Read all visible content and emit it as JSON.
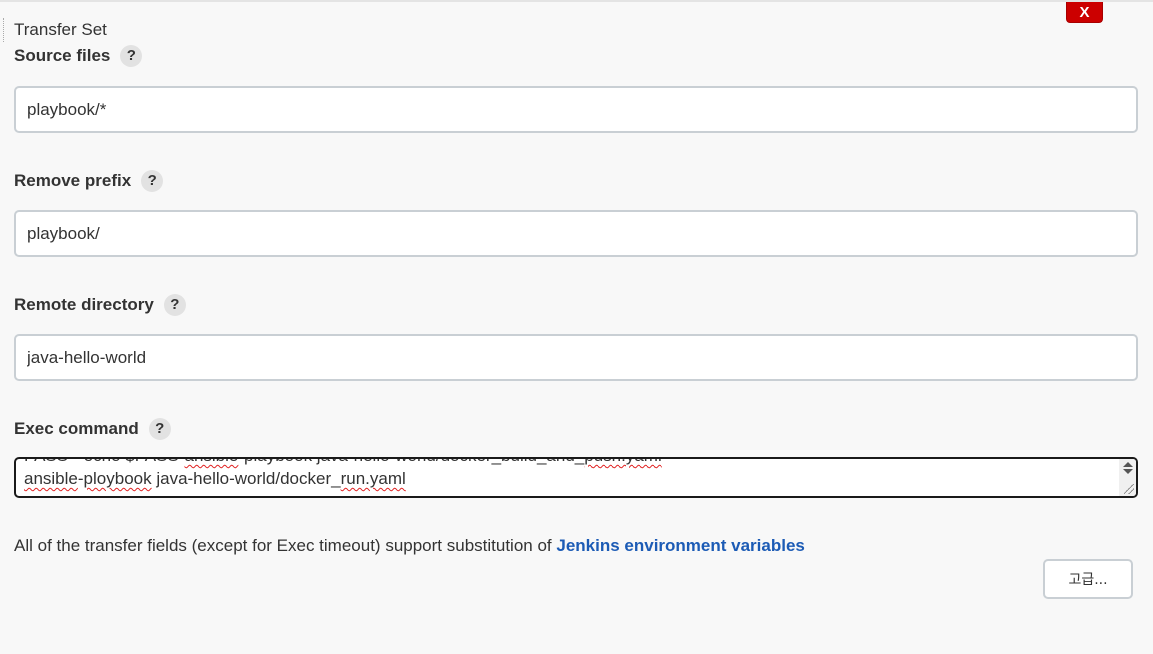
{
  "panel": {
    "title": "Transfer Set",
    "delete_label": "X"
  },
  "fields": {
    "source_files": {
      "label": "Source files",
      "help": "?",
      "value": "playbook/*"
    },
    "remove_prefix": {
      "label": "Remove prefix",
      "help": "?",
      "value": "playbook/"
    },
    "remote_directory": {
      "label": "Remote directory",
      "help": "?",
      "value": "java-hello-world"
    },
    "exec_command": {
      "label": "Exec command",
      "help": "?",
      "line1": {
        "a": "PASS=`echo $PASS`",
        "b": "ansible",
        "c": "-playbook java-hello-world/docker_build_and_",
        "d": "push.yaml"
      },
      "line2": {
        "a": "ansible",
        "b": "-",
        "c": "ploybook",
        "d": " java-hello-world/docker_",
        "e": "run.yaml"
      }
    }
  },
  "footer": {
    "note_text": "All of the transfer fields (except for Exec timeout) support substitution of ",
    "note_link": "Jenkins environment variables",
    "advanced_label": "고급..."
  },
  "colors": {
    "delete_bg": "#cc0000",
    "link": "#1c5bb5",
    "exec_border": "#1a1a1a",
    "spellcheck": "#e02020"
  },
  "icons": [
    "help-icon",
    "scroll-up-icon",
    "scroll-down-icon",
    "resize-grip-icon"
  ]
}
